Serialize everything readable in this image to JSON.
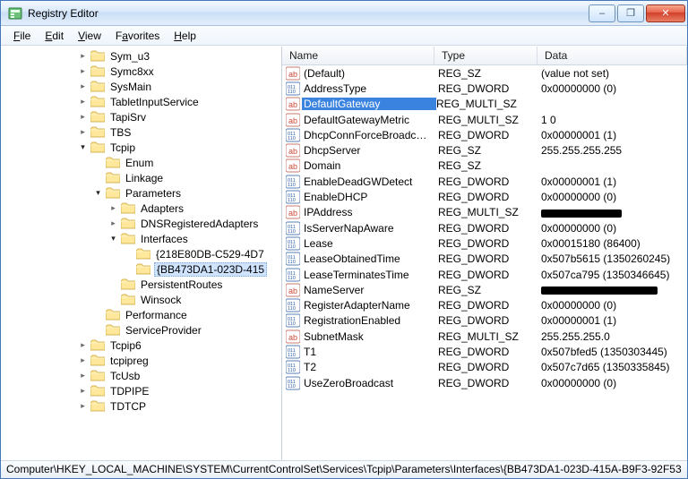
{
  "title": "Registry Editor",
  "win_icon": "regedit-icon",
  "winbtns": {
    "min": "–",
    "max": "❐",
    "close": "✕"
  },
  "menu": [
    {
      "label": "File",
      "ul": 0
    },
    {
      "label": "Edit",
      "ul": 0
    },
    {
      "label": "View",
      "ul": 0
    },
    {
      "label": "Favorites",
      "ul": 1
    },
    {
      "label": "Help",
      "ul": 0
    }
  ],
  "columns": {
    "name": "Name",
    "type": "Type",
    "data": "Data"
  },
  "status": "Computer\\HKEY_LOCAL_MACHINE\\SYSTEM\\CurrentControlSet\\Services\\Tcpip\\Parameters\\Interfaces\\{BB473DA1-023D-415A-B9F3-92F53",
  "tree": [
    {
      "depth": 5,
      "twisty": "closed",
      "label": "Sym_u3"
    },
    {
      "depth": 5,
      "twisty": "closed",
      "label": "Symc8xx"
    },
    {
      "depth": 5,
      "twisty": "closed",
      "label": "SysMain"
    },
    {
      "depth": 5,
      "twisty": "closed",
      "label": "TabletInputService"
    },
    {
      "depth": 5,
      "twisty": "closed",
      "label": "TapiSrv"
    },
    {
      "depth": 5,
      "twisty": "closed",
      "label": "TBS"
    },
    {
      "depth": 5,
      "twisty": "open",
      "label": "Tcpip"
    },
    {
      "depth": 6,
      "twisty": "none",
      "label": "Enum"
    },
    {
      "depth": 6,
      "twisty": "none",
      "label": "Linkage"
    },
    {
      "depth": 6,
      "twisty": "open",
      "label": "Parameters"
    },
    {
      "depth": 7,
      "twisty": "closed",
      "label": "Adapters"
    },
    {
      "depth": 7,
      "twisty": "closed",
      "label": "DNSRegisteredAdapters"
    },
    {
      "depth": 7,
      "twisty": "open",
      "label": "Interfaces"
    },
    {
      "depth": 8,
      "twisty": "none",
      "label": "{218E80DB-C529-4D7"
    },
    {
      "depth": 8,
      "twisty": "none",
      "label": "{BB473DA1-023D-415",
      "selected": true
    },
    {
      "depth": 7,
      "twisty": "none",
      "label": "PersistentRoutes"
    },
    {
      "depth": 7,
      "twisty": "none",
      "label": "Winsock"
    },
    {
      "depth": 6,
      "twisty": "none",
      "label": "Performance"
    },
    {
      "depth": 6,
      "twisty": "none",
      "label": "ServiceProvider"
    },
    {
      "depth": 5,
      "twisty": "closed",
      "label": "Tcpip6"
    },
    {
      "depth": 5,
      "twisty": "closed",
      "label": "tcpipreg"
    },
    {
      "depth": 5,
      "twisty": "closed",
      "label": "TcUsb"
    },
    {
      "depth": 5,
      "twisty": "closed",
      "label": "TDPIPE"
    },
    {
      "depth": 5,
      "twisty": "closed",
      "label": "TDTCP"
    }
  ],
  "values": [
    {
      "icon": "sz",
      "name": "(Default)",
      "type": "REG_SZ",
      "data": "(value not set)"
    },
    {
      "icon": "dword",
      "name": "AddressType",
      "type": "REG_DWORD",
      "data": "0x00000000 (0)"
    },
    {
      "icon": "sz",
      "name": "DefaultGateway",
      "type": "REG_MULTI_SZ",
      "data": "",
      "selected": true
    },
    {
      "icon": "sz",
      "name": "DefaultGatewayMetric",
      "type": "REG_MULTI_SZ",
      "data": "1 0"
    },
    {
      "icon": "dword",
      "name": "DhcpConnForceBroadcastF...",
      "type": "REG_DWORD",
      "data": "0x00000001 (1)"
    },
    {
      "icon": "sz",
      "name": "DhcpServer",
      "type": "REG_SZ",
      "data": "255.255.255.255"
    },
    {
      "icon": "sz",
      "name": "Domain",
      "type": "REG_SZ",
      "data": ""
    },
    {
      "icon": "dword",
      "name": "EnableDeadGWDetect",
      "type": "REG_DWORD",
      "data": "0x00000001 (1)"
    },
    {
      "icon": "dword",
      "name": "EnableDHCP",
      "type": "REG_DWORD",
      "data": "0x00000000 (0)"
    },
    {
      "icon": "sz",
      "name": "IPAddress",
      "type": "REG_MULTI_SZ",
      "data": "[REDACTED:90]"
    },
    {
      "icon": "dword",
      "name": "IsServerNapAware",
      "type": "REG_DWORD",
      "data": "0x00000000 (0)"
    },
    {
      "icon": "dword",
      "name": "Lease",
      "type": "REG_DWORD",
      "data": "0x00015180 (86400)"
    },
    {
      "icon": "dword",
      "name": "LeaseObtainedTime",
      "type": "REG_DWORD",
      "data": "0x507b5615 (1350260245)"
    },
    {
      "icon": "dword",
      "name": "LeaseTerminatesTime",
      "type": "REG_DWORD",
      "data": "0x507ca795 (1350346645)"
    },
    {
      "icon": "sz",
      "name": "NameServer",
      "type": "REG_SZ",
      "data": "[REDACTED:130]"
    },
    {
      "icon": "dword",
      "name": "RegisterAdapterName",
      "type": "REG_DWORD",
      "data": "0x00000000 (0)"
    },
    {
      "icon": "dword",
      "name": "RegistrationEnabled",
      "type": "REG_DWORD",
      "data": "0x00000001 (1)"
    },
    {
      "icon": "sz",
      "name": "SubnetMask",
      "type": "REG_MULTI_SZ",
      "data": "255.255.255.0"
    },
    {
      "icon": "dword",
      "name": "T1",
      "type": "REG_DWORD",
      "data": "0x507bfed5 (1350303445)"
    },
    {
      "icon": "dword",
      "name": "T2",
      "type": "REG_DWORD",
      "data": "0x507c7d65 (1350335845)"
    },
    {
      "icon": "dword",
      "name": "UseZeroBroadcast",
      "type": "REG_DWORD",
      "data": "0x00000000 (0)"
    }
  ]
}
